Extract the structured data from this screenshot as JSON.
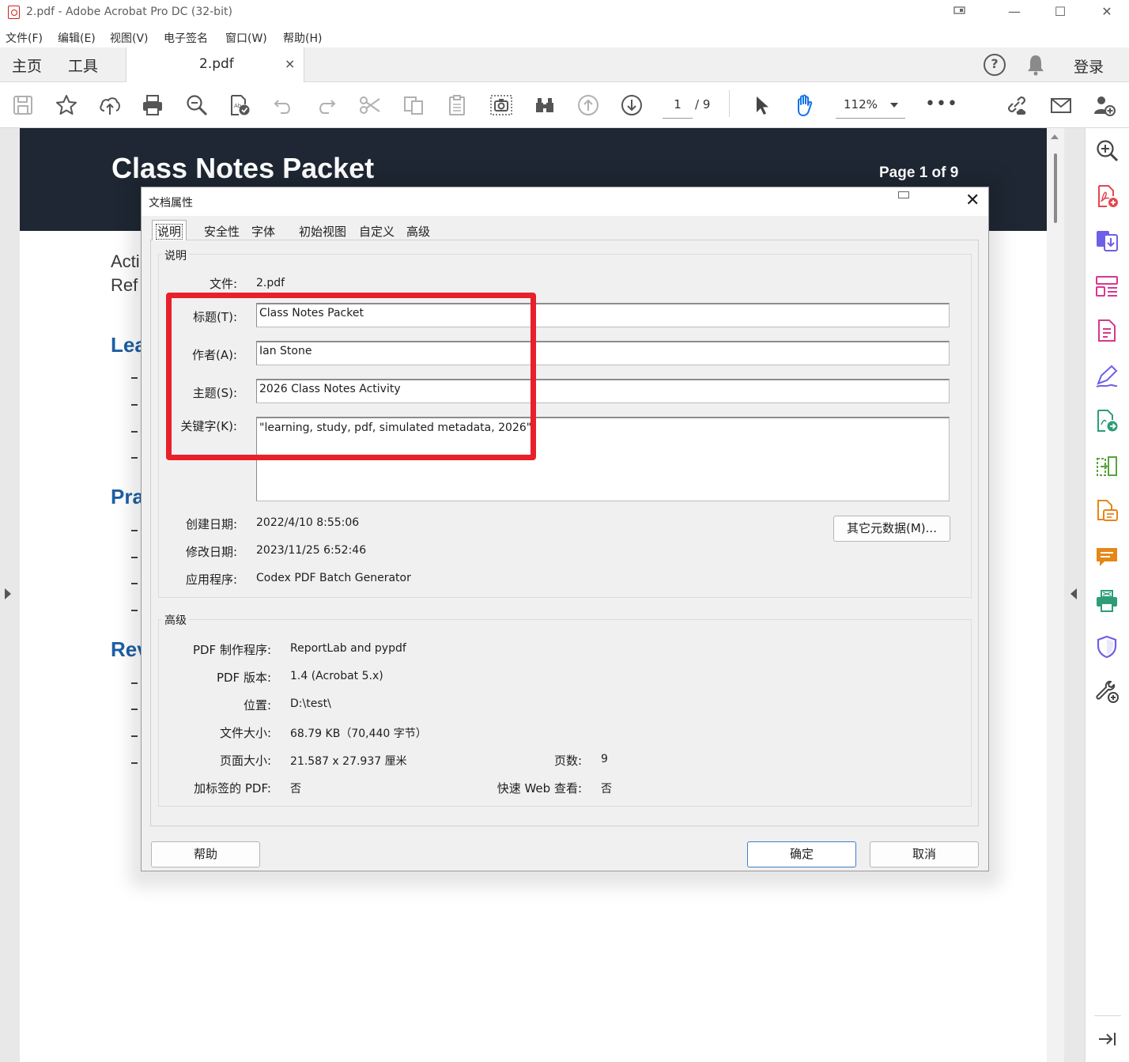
{
  "window": {
    "title": "2.pdf - Adobe Acrobat Pro DC (32-bit)",
    "minimize": "—",
    "maximize": "☐",
    "close": "✕"
  },
  "menubar": [
    "文件(F)",
    "编辑(E)",
    "视图(V)",
    "电子签名",
    "窗口(W)",
    "帮助(H)"
  ],
  "tabbar": {
    "home": "主页",
    "tools": "工具",
    "doc_tab": "2.pdf",
    "close": "×",
    "help": "?",
    "signin": "登录"
  },
  "toolbar": {
    "page_current": "1",
    "page_total": "/ 9",
    "zoom": "112%",
    "more": "•••"
  },
  "document": {
    "banner_title": "Class Notes Packet",
    "banner_page": "Page 1 of 9",
    "left_text_1": "Acti",
    "left_text_2": "Ref",
    "heading_1": "Lea",
    "heading_2": "Pra",
    "heading_3": "Rev"
  },
  "dialog": {
    "title": "文档属性",
    "tabs": [
      "说明",
      "安全性",
      "字体",
      "初始视图",
      "自定义",
      "高级"
    ],
    "active_tab": "说明",
    "description_group": "说明",
    "file_label": "文件:",
    "file_value": "2.pdf",
    "title_label": "标题(T):",
    "title_value": "Class Notes Packet",
    "author_label": "作者(A):",
    "author_value": "Ian Stone",
    "subject_label": "主题(S):",
    "subject_value": "2026 Class Notes Activity",
    "keywords_label": "关键字(K):",
    "keywords_value": "\"learning, study, pdf, simulated metadata, 2026\"",
    "created_label": "创建日期:",
    "created_value": "2022/4/10 8:55:06",
    "modified_label": "修改日期:",
    "modified_value": "2023/11/25 6:52:46",
    "application_label": "应用程序:",
    "application_value": "Codex PDF Batch Generator",
    "more_metadata_button": "其它元数据(M)...",
    "advanced_group": "高级",
    "producer_label": "PDF 制作程序:",
    "producer_value": "ReportLab and pypdf",
    "version_label": "PDF 版本:",
    "version_value": "1.4 (Acrobat 5.x)",
    "location_label": "位置:",
    "location_value": "D:\\test\\",
    "filesize_label": "文件大小:",
    "filesize_value": "68.79 KB（70,440 字节）",
    "pagesize_label": "页面大小:",
    "pagesize_value": "21.587 x 27.937 厘米",
    "pagecount_label": "页数:",
    "pagecount_value": "9",
    "tagged_label": "加标签的 PDF:",
    "tagged_value": "否",
    "fastweb_label": "快速 Web 查看:",
    "fastweb_value": "否",
    "help_button": "帮助",
    "ok_button": "确定",
    "cancel_button": "取消"
  },
  "colors": {
    "banner": "#1e2733",
    "heading_blue": "#1d5fa5",
    "highlight_red": "#e8202a",
    "hand_tool_blue": "#1473e6"
  }
}
